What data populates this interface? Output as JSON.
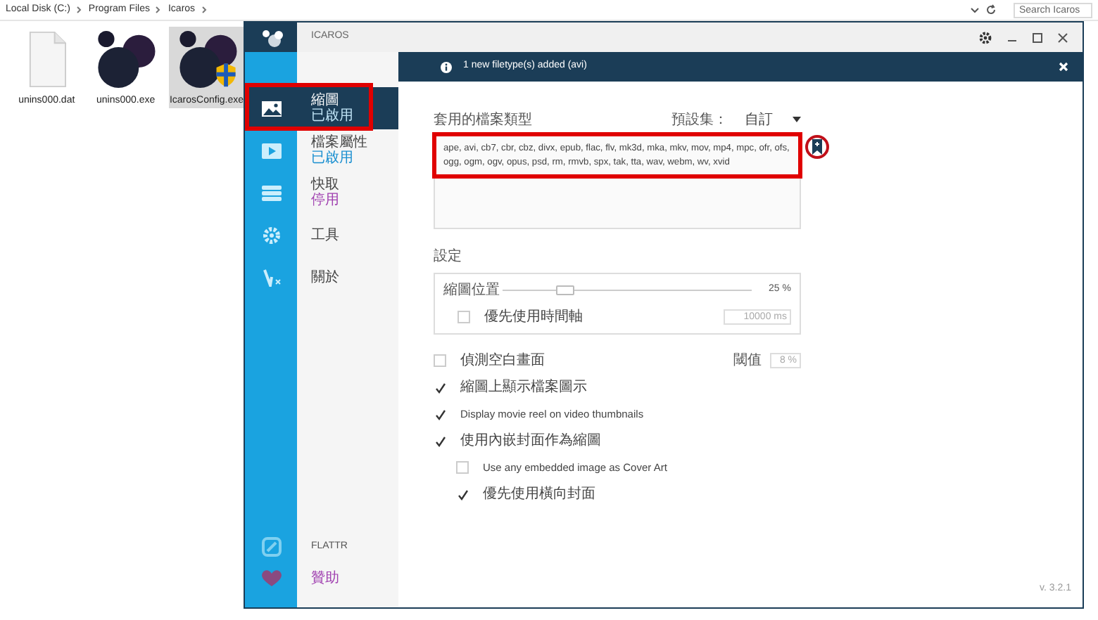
{
  "explorer": {
    "breadcrumb": [
      "Local Disk (C:)",
      "Program Files",
      "Icaros"
    ],
    "search": {
      "placeholder": "Search Icaros"
    },
    "files": [
      {
        "name": "unins000.dat",
        "kind": "document",
        "selected": false
      },
      {
        "name": "unins000.exe",
        "kind": "app",
        "selected": false
      },
      {
        "name": "IcarosConfig.exe",
        "kind": "app-shield",
        "selected": true
      }
    ]
  },
  "window": {
    "title": "ICAROS",
    "notification": "1 new filetype(s) added (avi)"
  },
  "nav": [
    {
      "kind": "image",
      "label": "縮圖",
      "status": "已啟用",
      "enabled": true,
      "selected": true,
      "highlighted": true
    },
    {
      "kind": "play",
      "label": "檔案屬性",
      "status": "已啟用",
      "enabled": true,
      "selected": false,
      "highlighted": false
    },
    {
      "kind": "stack",
      "label": "快取",
      "status": "停用",
      "enabled": false,
      "selected": false,
      "highlighted": false
    },
    {
      "kind": "gear",
      "label": "工具",
      "selected": false,
      "highlighted": false
    },
    {
      "kind": "about",
      "label": "關於",
      "selected": false,
      "highlighted": false
    }
  ],
  "nav_footer": [
    {
      "kind": "flattr",
      "label": "FLATTR"
    },
    {
      "kind": "heart",
      "label": "贊助"
    }
  ],
  "filetypes": {
    "label": "套用的檔案類型",
    "preset_label": "預設集：",
    "preset": "自訂",
    "value": "ape, avi, cb7, cbr, cbz, divx, epub, flac, flv, mk3d, mka, mkv, mov, mp4, mpc, ofr, ofs, ogg, ogm, ogv, opus, psd, rm, rmvb, spx, tak, tta, wav, webm, wv, xvid",
    "highlighted": true,
    "add_circled": true
  },
  "settings": {
    "heading": "設定",
    "offset_label": "縮圖位置",
    "level": 0.25,
    "offset_reading": "25 %",
    "prefer_label": "優先使用時間軸",
    "prefer_checked": false,
    "ms_value": "10000 ms"
  },
  "options": [
    {
      "label": "偵測空白畫面",
      "checked": false,
      "threshold_label": "閾值",
      "threshold_value": "8 %"
    },
    {
      "label": "縮圖上顯示檔案圖示",
      "checked": true
    },
    {
      "label": "Display movie reel on video thumbnails",
      "checked": true
    },
    {
      "label": "使用內嵌封面作為縮圖",
      "checked": true,
      "children": [
        {
          "label": "Use any embedded image as Cover Art",
          "checked": false
        },
        {
          "label": "優先使用橫向封面",
          "checked": true
        }
      ]
    }
  ],
  "version": "v. 3.2.1"
}
